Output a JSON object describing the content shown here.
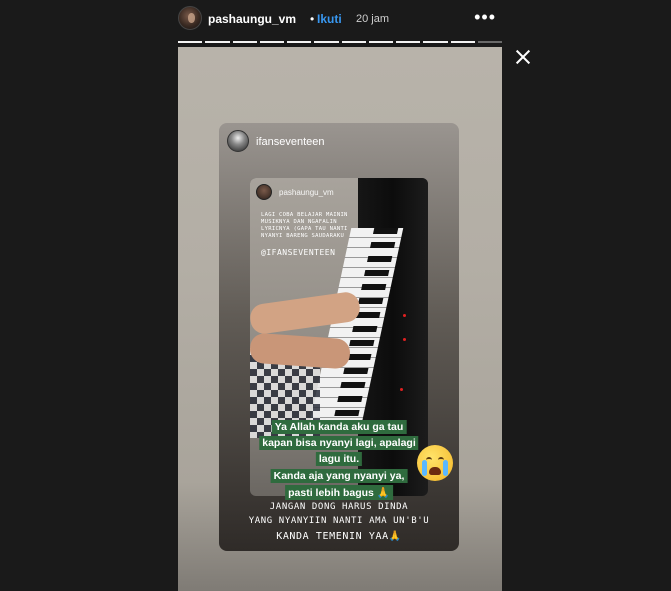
{
  "header": {
    "username": "pashaungu_vm",
    "separator": "•",
    "follow_label": "Ikuti",
    "time": "20 jam",
    "more_icon": "more-horizontal-icon",
    "more_glyph": "•••"
  },
  "progress": {
    "segments": 12,
    "current": 12
  },
  "close_icon": "close-icon",
  "story": {
    "repost_username": "ifanseventeen",
    "inner": {
      "username": "pashaungu_vm",
      "caption": [
        "LAGI COBA BELAJAR MAININ",
        "MUSIKNYA DAN NGAFALIN",
        "LYRICNYA (GAPA TAU NANTI",
        "NYANYI BARENG SAUDARAKU"
      ],
      "tag": "@IFANSEVENTEEN"
    },
    "green_text": [
      "Ya Allah kanda aku ga tau",
      "kapan bisa nyanyi lagi, apalagi",
      "lagu itu.",
      "Kanda aja yang nyanyi ya,",
      "pasti lebih bagus 🙏"
    ],
    "emoji": "crying-face-icon",
    "reply_text": [
      "JANGAN DONG HARUS DINDA",
      "YANG NYANYIIN NANTI AMA UN'B'U",
      "KANDA TEMENIN YAA🙏"
    ]
  },
  "colors": {
    "background": "#1a1a1a",
    "follow": "#3897f0",
    "green_highlight": "#2f6b3e"
  }
}
